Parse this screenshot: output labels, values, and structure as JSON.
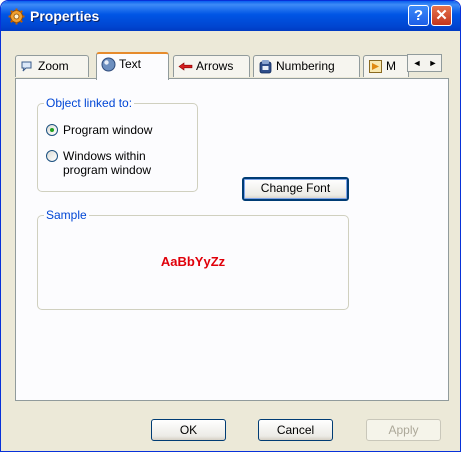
{
  "window": {
    "title": "Properties",
    "help_label": "?",
    "close_label": "✕"
  },
  "tabs": [
    {
      "label": "Zoom",
      "icon": "zoom-icon"
    },
    {
      "label": "Text",
      "icon": "text-icon"
    },
    {
      "label": "Arrows",
      "icon": "arrow-icon"
    },
    {
      "label": "Numbering",
      "icon": "numbering-icon"
    },
    {
      "label": "M",
      "icon": "misc-icon"
    }
  ],
  "tab_scroll": {
    "left": "◄",
    "right": "►"
  },
  "object_linked": {
    "legend": "Object linked to:",
    "options": [
      {
        "label": "Program window",
        "checked": true
      },
      {
        "label_line1": "Windows within",
        "label_line2": "program window",
        "checked": false
      }
    ]
  },
  "change_font_label": "Change Font",
  "sample": {
    "legend": "Sample",
    "text": "AaBbYyZz",
    "color": "#e0000a"
  },
  "footer": {
    "ok_label": "OK",
    "cancel_label": "Cancel",
    "apply_label": "Apply"
  },
  "colors": {
    "title_bar": "#0055e5",
    "tab_highlight": "#e68b2c",
    "group_legend": "#0046d5"
  }
}
